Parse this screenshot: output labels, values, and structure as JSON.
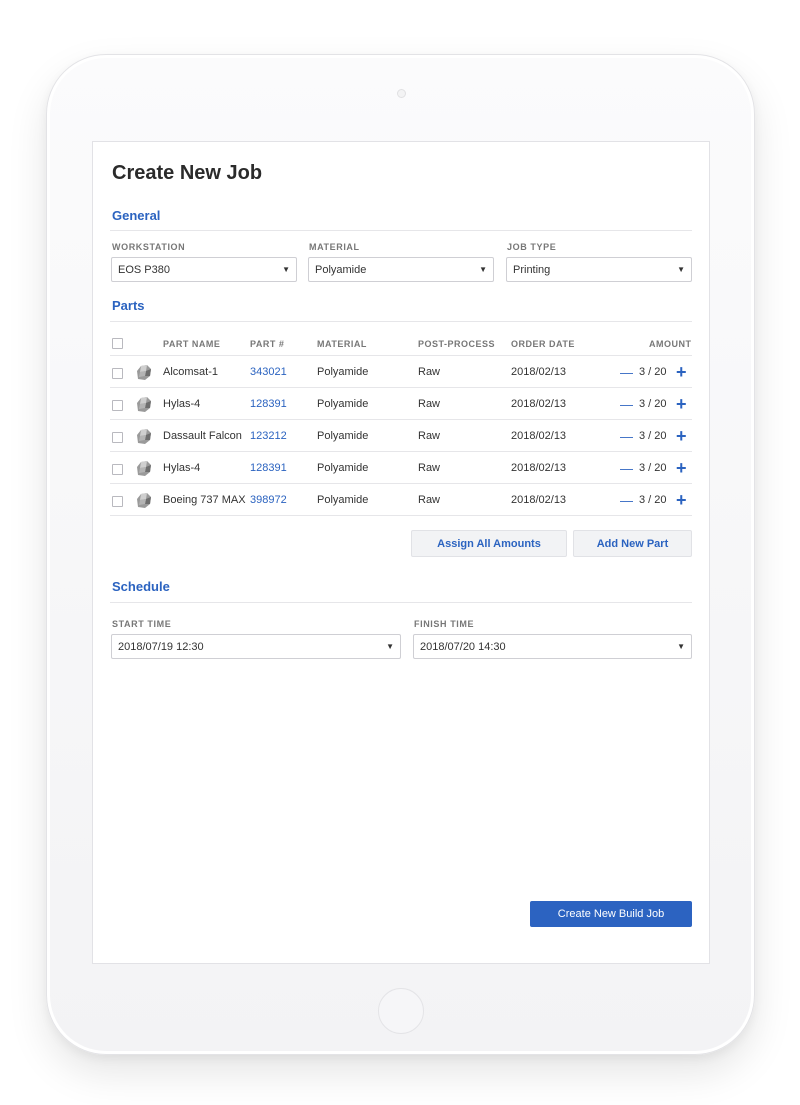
{
  "page": {
    "title": "Create New Job"
  },
  "general": {
    "title": "General",
    "workstation": {
      "label": "WORKSTATION",
      "value": "EOS P380"
    },
    "material": {
      "label": "MATERIAL",
      "value": "Polyamide"
    },
    "job_type": {
      "label": "JOB TYPE",
      "value": "Printing"
    }
  },
  "parts": {
    "title": "Parts",
    "columns": {
      "name": "PART NAME",
      "number": "PART #",
      "material": "MATERIAL",
      "post_process": "POST-PROCESS",
      "order_date": "ORDER DATE",
      "amount": "AMOUNT"
    },
    "rows": [
      {
        "name": "Alcomsat-1",
        "number": "343021",
        "material": "Polyamide",
        "post_process": "Raw",
        "order_date": "2018/02/13",
        "amount": "3 / 20"
      },
      {
        "name": "Hylas-4",
        "number": "128391",
        "material": "Polyamide",
        "post_process": "Raw",
        "order_date": "2018/02/13",
        "amount": "3 / 20"
      },
      {
        "name": "Dassault Falcon",
        "number": "123212",
        "material": "Polyamide",
        "post_process": "Raw",
        "order_date": "2018/02/13",
        "amount": "3 / 20"
      },
      {
        "name": "Hylas-4",
        "number": "128391",
        "material": "Polyamide",
        "post_process": "Raw",
        "order_date": "2018/02/13",
        "amount": "3 / 20"
      },
      {
        "name": "Boeing 737 MAX",
        "number": "398972",
        "material": "Polyamide",
        "post_process": "Raw",
        "order_date": "2018/02/13",
        "amount": "3 / 20"
      }
    ],
    "assign_all_label": "Assign All Amounts",
    "add_new_label": "Add New Part"
  },
  "schedule": {
    "title": "Schedule",
    "start": {
      "label": "START TIME",
      "value": "2018/07/19 12:30"
    },
    "finish": {
      "label": "FINISH TIME",
      "value": "2018/07/20 14:30"
    }
  },
  "actions": {
    "create_label": "Create New Build Job"
  },
  "icons": {
    "caret": "▼",
    "minus": "—",
    "plus": "+"
  },
  "colors": {
    "accent": "#2c63c1",
    "text": "#333333",
    "muted": "#777777"
  }
}
